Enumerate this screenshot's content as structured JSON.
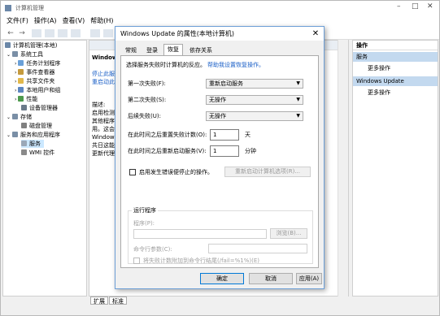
{
  "window": {
    "title": "计算机管理",
    "controls": {
      "minimize": "–",
      "maximize": "□",
      "close": "✕"
    }
  },
  "menu": [
    "文件(F)",
    "操作(A)",
    "查看(V)",
    "帮助(H)"
  ],
  "toolbar": {
    "back": "←",
    "forward": "→"
  },
  "tree": {
    "root": "计算机管理(本地)",
    "items": [
      {
        "label": "系统工具",
        "icon_color": "#7a8fa6"
      },
      {
        "label": "任务计划程序",
        "icon_color": "#6aa0d8"
      },
      {
        "label": "事件查看器",
        "icon_color": "#c59a3c"
      },
      {
        "label": "共享文件夹",
        "icon_color": "#e2b84b"
      },
      {
        "label": "本地用户和组",
        "icon_color": "#5c86c0"
      },
      {
        "label": "性能",
        "icon_color": "#4d9a4d"
      },
      {
        "label": "设备管理器",
        "icon_color": "#6b7a8a"
      },
      {
        "label": "存储",
        "icon_color": "#7a8fa6"
      },
      {
        "label": "磁盘管理",
        "icon_color": "#808080"
      },
      {
        "label": "服务和应用程序",
        "icon_color": "#7a8fa6"
      },
      {
        "label": "服务",
        "icon_color": "#9aa8b8"
      },
      {
        "label": "WMI 控件",
        "icon_color": "#8a8a8a"
      }
    ]
  },
  "middle": {
    "heading": "Windows",
    "links": [
      "停止此服",
      "重启动此"
    ],
    "desc_lines": [
      "描述:",
      "启用检测",
      "其他程序",
      "用。这会",
      "Windows",
      "共日这能",
      "更新代理"
    ]
  },
  "actions": {
    "head": "操作",
    "sections": [
      {
        "title": "服务",
        "item": "更多操作"
      },
      {
        "title": "Windows Update",
        "item": "更多操作"
      }
    ]
  },
  "bottom_tabs": [
    "扩展",
    "标准"
  ],
  "dialog": {
    "title": "Windows Update 的属性(本地计算机)",
    "close": "✕",
    "tabs": [
      "常规",
      "登录",
      "恢复",
      "依存关系"
    ],
    "active_tab": "恢复",
    "intro_text": "选择服务失败时计算机的反应。",
    "intro_link": "帮助我设置恢复操作。",
    "first_failure": {
      "label": "第一次失败(F):",
      "value": "重新启动服务"
    },
    "second_failure": {
      "label": "第二次失败(S):",
      "value": "无操作"
    },
    "subsequent_failure": {
      "label": "后续失败(U):",
      "value": "无操作"
    },
    "reset_count": {
      "label": "在此时间之后重置失败计数(O):",
      "value": "1",
      "unit": "天"
    },
    "restart_after": {
      "label": "在此时间之后重新启动服务(V):",
      "value": "1",
      "unit": "分钟"
    },
    "enable_actions_checkbox": "启用发生错误便停止的操作。",
    "restart_options_button": "重新启动计算机选项(R)...",
    "run_program_group": "运行程序",
    "program_label": "程序(P):",
    "browse_button": "浏览(B)...",
    "cmd_params_label": "命令行参数(C):",
    "append_fail_count": "将失败计数附加到命令行结尾(/fail=%1%)(E)",
    "ok": "确定",
    "cancel": "取消",
    "apply": "应用(A)"
  }
}
